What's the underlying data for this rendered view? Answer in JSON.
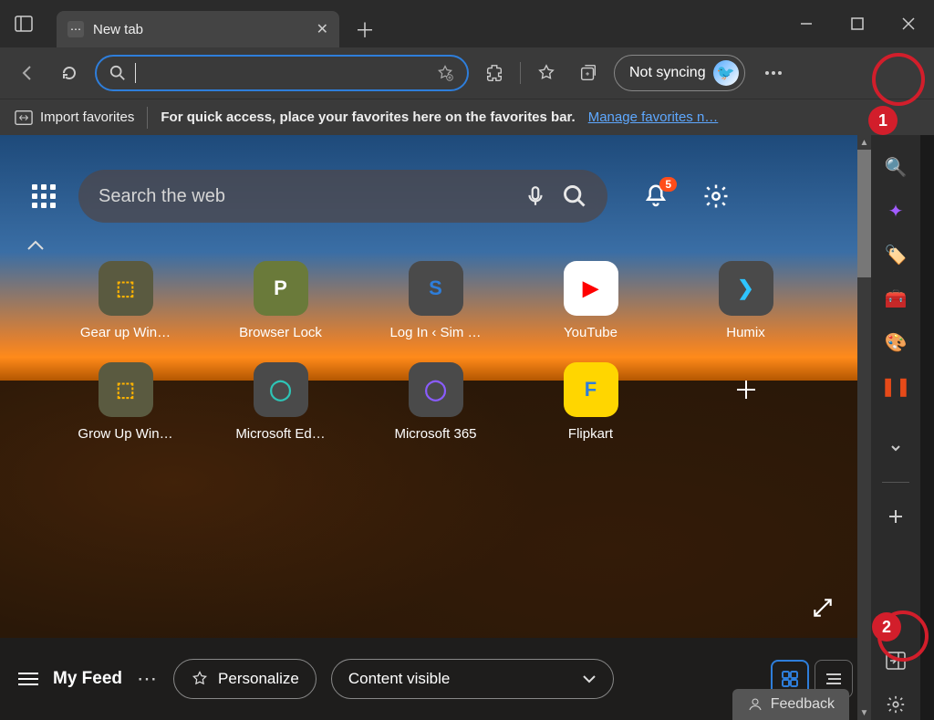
{
  "tab": {
    "title": "New tab"
  },
  "toolbar": {
    "not_syncing": "Not syncing"
  },
  "favbar": {
    "import": "Import favorites",
    "hint": "For quick access, place your favorites here on the favorites bar.",
    "manage": "Manage favorites n…"
  },
  "ntp": {
    "search_placeholder": "Search the web",
    "bell_count": "5",
    "tiles": [
      {
        "label": "Gear up Win…",
        "bg": "#5a5a40",
        "glyph": "⬚",
        "glyph_color": "#ffb300"
      },
      {
        "label": "Browser Lock",
        "bg": "#6a7a3a",
        "glyph": "P",
        "glyph_color": "#ffffff"
      },
      {
        "label": "Log In ‹ Sim …",
        "bg": "#4a4a4a",
        "glyph": "S",
        "glyph_color": "#2e7edb"
      },
      {
        "label": "YouTube",
        "bg": "#ffffff",
        "glyph": "▶",
        "glyph_color": "#ff0000"
      },
      {
        "label": "Humix",
        "bg": "#4a4a4a",
        "glyph": "❯",
        "glyph_color": "#2ec4ff"
      },
      {
        "label": "Grow Up Win…",
        "bg": "#5a5a40",
        "glyph": "⬚",
        "glyph_color": "#ffb300"
      },
      {
        "label": "Microsoft Ed…",
        "bg": "#4a4a4a",
        "glyph": "◯",
        "glyph_color": "#2ec4b6"
      },
      {
        "label": "Microsoft 365",
        "bg": "#4a4a4a",
        "glyph": "◯",
        "glyph_color": "#8a5cff"
      },
      {
        "label": "Flipkart",
        "bg": "#ffd600",
        "glyph": "F",
        "glyph_color": "#2e7edb"
      }
    ]
  },
  "feed": {
    "title": "My Feed",
    "personalize": "Personalize",
    "content_visible": "Content visible",
    "feedback": "Feedback"
  },
  "callouts": {
    "one": "1",
    "two": "2"
  },
  "sidebar_icons": [
    {
      "name": "search-icon",
      "glyph": "🔍",
      "color": "#2e7edb"
    },
    {
      "name": "sparkle-icon",
      "glyph": "✦",
      "color": "#a15cff"
    },
    {
      "name": "tag-icon",
      "glyph": "🏷️",
      "color": "#2e7edb"
    },
    {
      "name": "shopping-icon",
      "glyph": "🧰",
      "color": "#ffb300"
    },
    {
      "name": "games-icon",
      "glyph": "🎨",
      "color": "#ff7a59"
    },
    {
      "name": "office-icon",
      "glyph": "❚❚",
      "color": "#e64a19"
    }
  ]
}
